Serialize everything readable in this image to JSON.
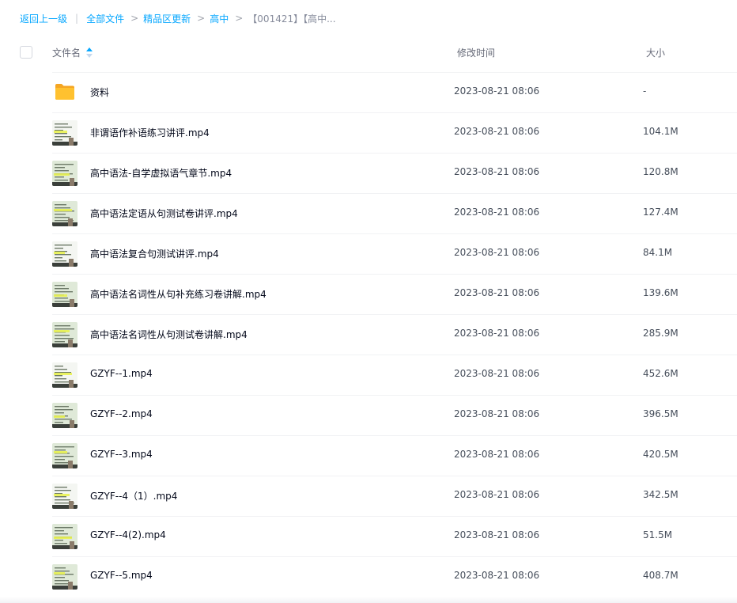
{
  "breadcrumb": {
    "back": "返回上一级",
    "items": [
      "全部文件",
      "精品区更新",
      "高中"
    ],
    "current": "【001421】【高中..."
  },
  "header": {
    "name": "文件名",
    "time": "修改时间",
    "size": "大小"
  },
  "colors": {
    "accent": "#06a7ff",
    "folder": "#ffc12f"
  },
  "files": [
    {
      "type": "folder",
      "name": "资料",
      "time": "2023-08-21 08:06",
      "size": "-"
    },
    {
      "type": "video",
      "name": "非谓语作补语练习讲评.mp4",
      "time": "2023-08-21 08:06",
      "size": "104.1M"
    },
    {
      "type": "video",
      "name": "高中语法-自学虚拟语气章节.mp4",
      "time": "2023-08-21 08:06",
      "size": "120.8M"
    },
    {
      "type": "video",
      "name": "高中语法定语从句测试卷讲评.mp4",
      "time": "2023-08-21 08:06",
      "size": "127.4M"
    },
    {
      "type": "video",
      "name": "高中语法复合句测试讲评.mp4",
      "time": "2023-08-21 08:06",
      "size": "84.1M"
    },
    {
      "type": "video",
      "name": "高中语法名词性从句补充练习卷讲解.mp4",
      "time": "2023-08-21 08:06",
      "size": "139.6M"
    },
    {
      "type": "video",
      "name": "高中语法名词性从句测试卷讲解.mp4",
      "time": "2023-08-21 08:06",
      "size": "285.9M"
    },
    {
      "type": "video",
      "name": "GZYF--1.mp4",
      "time": "2023-08-21 08:06",
      "size": "452.6M"
    },
    {
      "type": "video",
      "name": "GZYF--2.mp4",
      "time": "2023-08-21 08:06",
      "size": "396.5M"
    },
    {
      "type": "video",
      "name": "GZYF--3.mp4",
      "time": "2023-08-21 08:06",
      "size": "420.5M"
    },
    {
      "type": "video",
      "name": "GZYF--4（1）.mp4",
      "time": "2023-08-21 08:06",
      "size": "342.5M"
    },
    {
      "type": "video",
      "name": "GZYF--4(2).mp4",
      "time": "2023-08-21 08:06",
      "size": "51.5M"
    },
    {
      "type": "video",
      "name": "GZYF--5.mp4",
      "time": "2023-08-21 08:06",
      "size": "408.7M"
    }
  ]
}
